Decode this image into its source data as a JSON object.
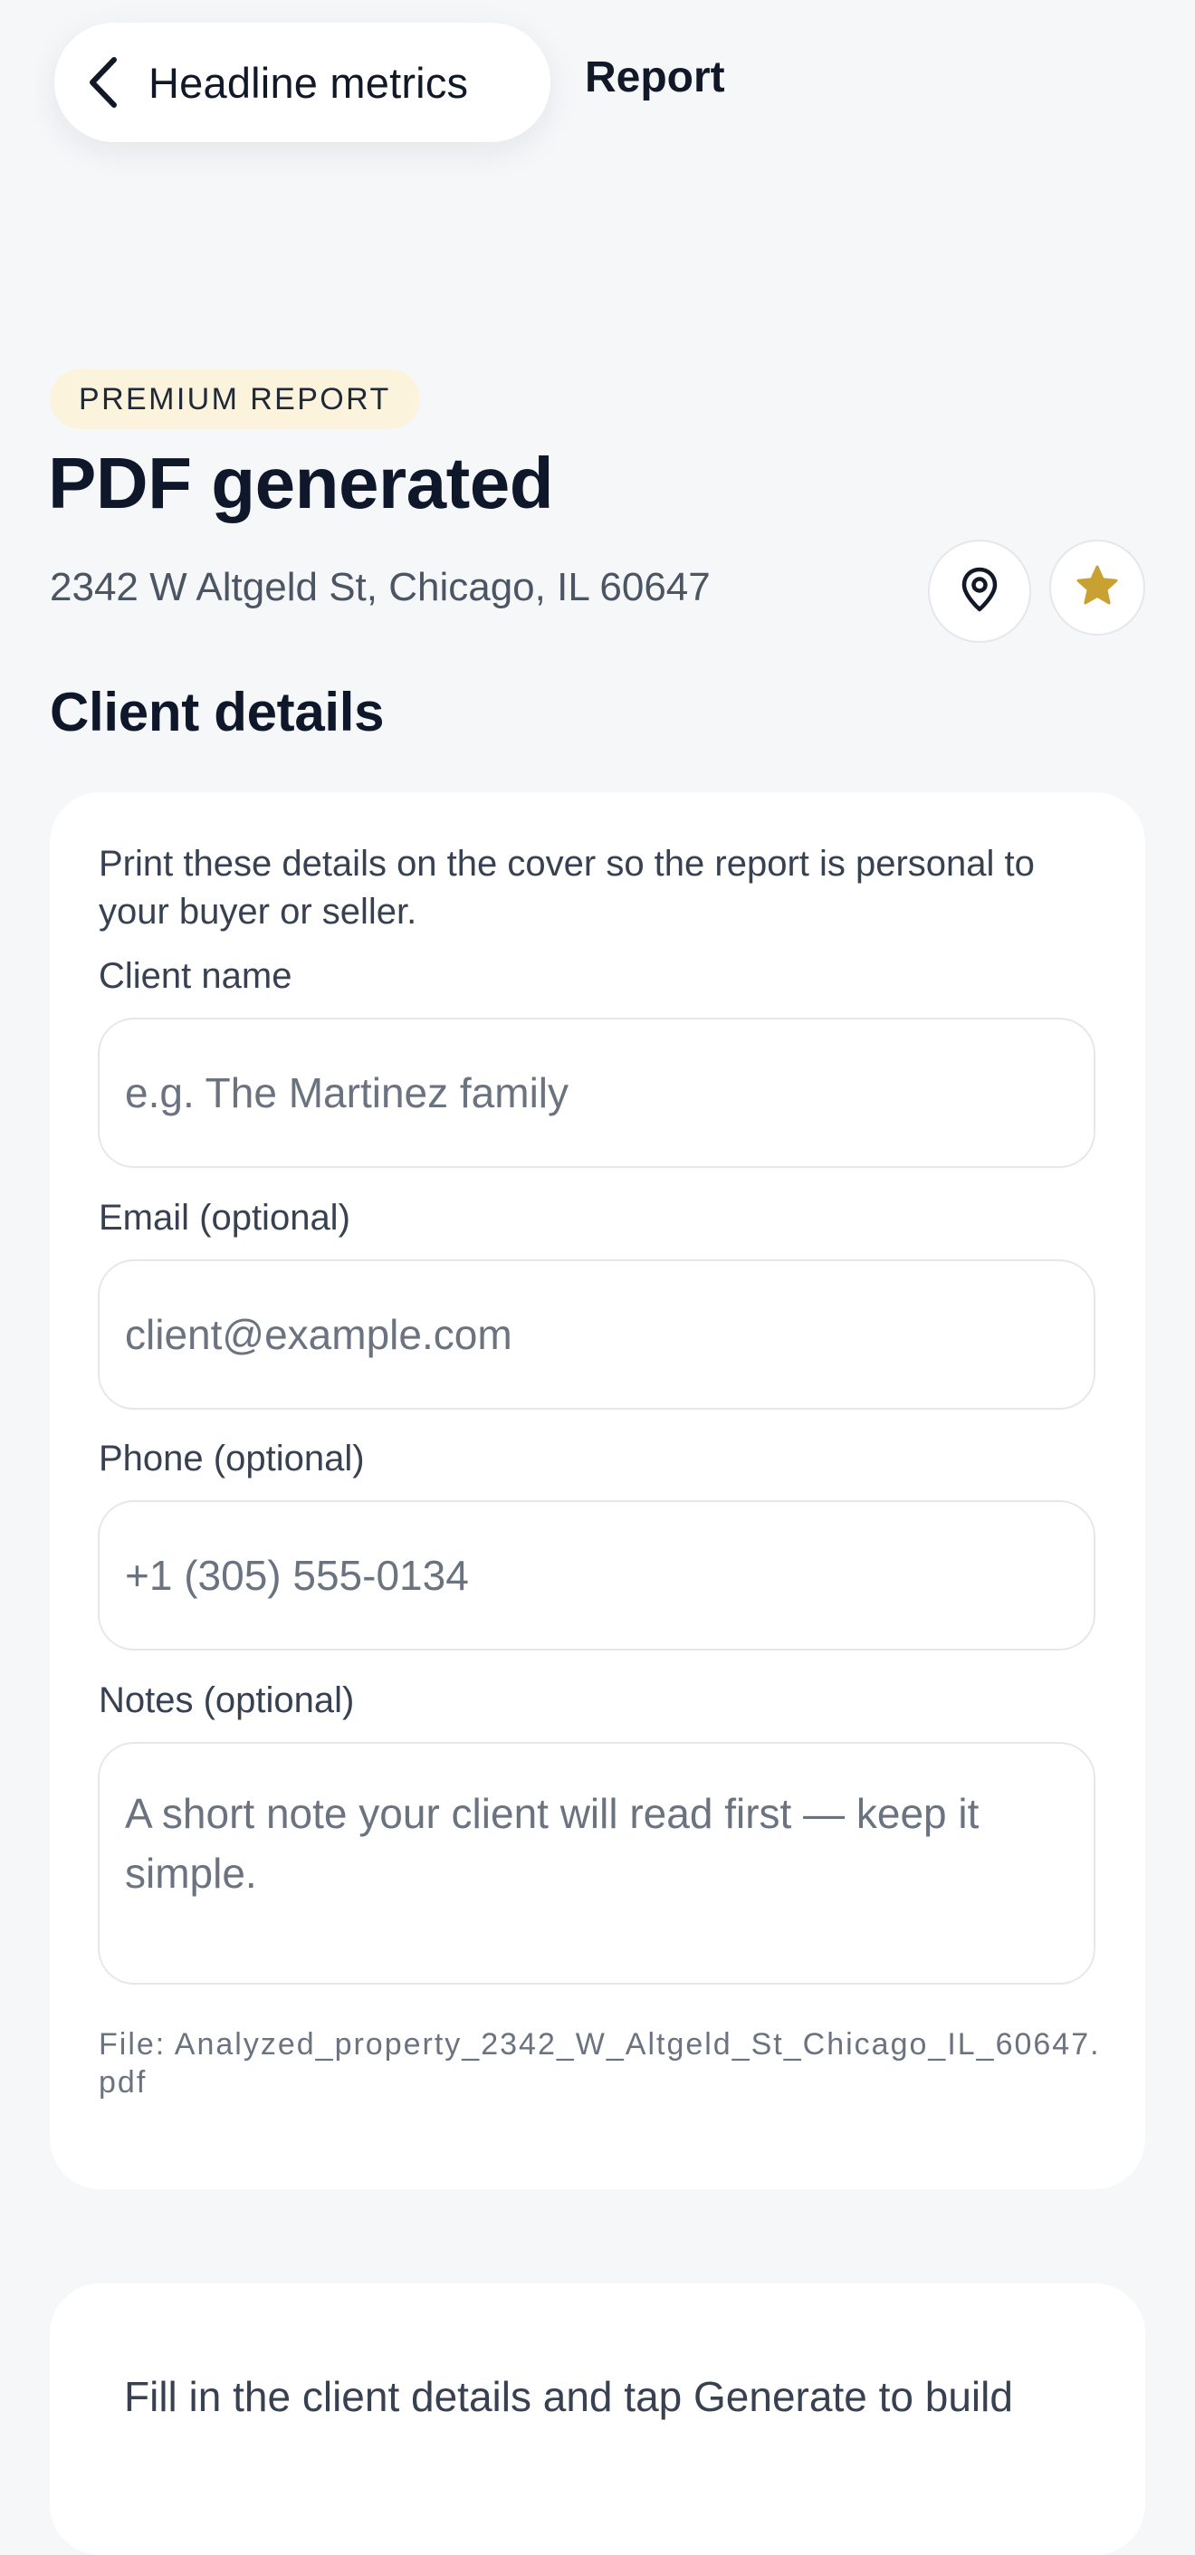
{
  "header": {
    "back_label": "Headline metrics",
    "title": "Report"
  },
  "badge": "PREMIUM REPORT",
  "page": {
    "title": "PDF generated",
    "address": "2342 W Altgeld St, Chicago, IL 60647"
  },
  "actions": {
    "location_icon": "map-pin-icon",
    "favorite_icon": "star-icon",
    "accent_color": "#c9a132"
  },
  "client_details": {
    "section_title": "Client details",
    "intro": "Print these details on the cover so the report is personal to your buyer or seller.",
    "fields": [
      {
        "label": "Client name",
        "placeholder": "e.g. The Martinez family",
        "value": ""
      },
      {
        "label": "Email (optional)",
        "placeholder": "client@example.com",
        "value": ""
      },
      {
        "label": "Phone (optional)",
        "placeholder": "+1 (305) 555-0134",
        "value": ""
      },
      {
        "label": "Notes (optional)",
        "placeholder": "A short note your client will read first — keep it simple.",
        "value": ""
      }
    ],
    "file_line": "File: Analyzed_property_2342_W_Altgeld_St_Chicago_IL_60647.pdf"
  },
  "generate_card": {
    "text": "Fill in the client details and tap Generate to build"
  }
}
